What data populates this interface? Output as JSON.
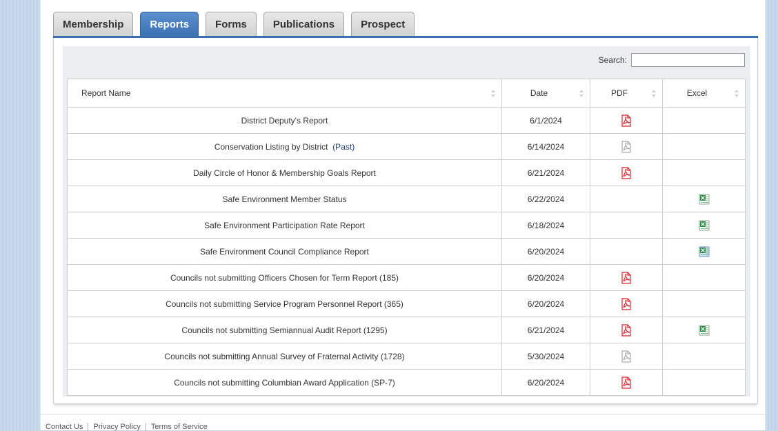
{
  "tabs": [
    "Membership",
    "Reports",
    "Forms",
    "Publications",
    "Prospect"
  ],
  "active_tab": "Reports",
  "search": {
    "label": "Search:",
    "value": ""
  },
  "columns": {
    "name": "Report Name",
    "date": "Date",
    "pdf": "PDF",
    "excel": "Excel"
  },
  "rows": [
    {
      "name": "District Deputy's Report",
      "date": "6/1/2024",
      "pdf": "active",
      "excel": "none"
    },
    {
      "name": "Conservation Listing by District",
      "past_link": "(Past)",
      "date": "6/14/2024",
      "pdf": "inactive",
      "excel": "none"
    },
    {
      "name": "Daily Circle of Honor & Membership Goals Report",
      "date": "6/21/2024",
      "pdf": "active",
      "excel": "none"
    },
    {
      "name": "Safe Environment Member Status",
      "date": "6/22/2024",
      "pdf": "none",
      "excel": "active"
    },
    {
      "name": "Safe Environment Participation Rate Report",
      "date": "6/18/2024",
      "pdf": "none",
      "excel": "active"
    },
    {
      "name": "Safe Environment Council Compliance Report",
      "date": "6/20/2024",
      "pdf": "none",
      "excel": "selected"
    },
    {
      "name": "Councils not submitting Officers Chosen for Term Report (185)",
      "date": "6/20/2024",
      "pdf": "active",
      "excel": "none"
    },
    {
      "name": "Councils not submitting Service Program Personnel Report (365)",
      "date": "6/20/2024",
      "pdf": "active",
      "excel": "none"
    },
    {
      "name": "Councils not submitting Semiannual Audit Report (1295)",
      "date": "6/21/2024",
      "pdf": "active",
      "excel": "active"
    },
    {
      "name": "Councils not submitting Annual Survey of Fraternal Activity (1728)",
      "date": "5/30/2024",
      "pdf": "inactive",
      "excel": "none"
    },
    {
      "name": "Councils not submitting Columbian Award Application (SP-7)",
      "date": "6/20/2024",
      "pdf": "active",
      "excel": "none"
    }
  ],
  "footer": [
    "Contact Us",
    "Privacy Policy",
    "Terms of Service"
  ],
  "icons": {
    "pdf": "pdf-file-icon",
    "excel": "excel-file-icon",
    "sort": "sort-arrows-icon"
  },
  "colors": {
    "tab_active": "#3b72b4",
    "pdf_red": "#d8232a",
    "excel_green": "#1d8a3a",
    "page_bg": "#c6d7ea"
  }
}
